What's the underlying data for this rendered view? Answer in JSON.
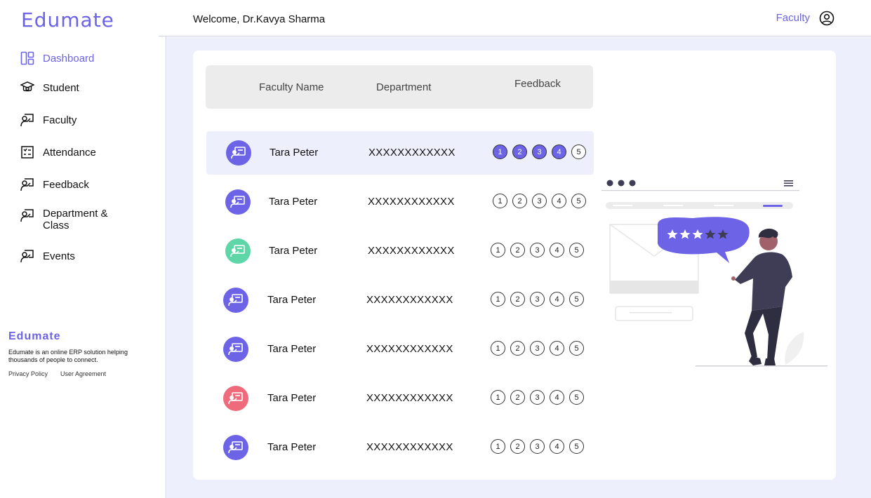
{
  "brand": {
    "name": "Edumate"
  },
  "header": {
    "welcome": "Welcome, Dr.Kavya Sharma",
    "role": "Faculty",
    "profile_icon": "user-circle-icon"
  },
  "sidebar": {
    "items": [
      {
        "label": "Dashboard",
        "icon": "dashboard-icon",
        "active": true
      },
      {
        "label": "Student",
        "icon": "graduation-cap-icon"
      },
      {
        "label": "Faculty",
        "icon": "teacher-icon"
      },
      {
        "label": "Attendance",
        "icon": "checklist-icon"
      },
      {
        "label": "Feedback",
        "icon": "teacher-icon"
      },
      {
        "label": "Department & Class",
        "icon": "teacher-icon"
      },
      {
        "label": "Events",
        "icon": "teacher-icon"
      }
    ]
  },
  "footer": {
    "brand": "Edumate",
    "description": "Edumate is an online ERP solution helping thousands of people to connect.",
    "links": [
      "Privacy Policy",
      "User Agreement"
    ]
  },
  "table": {
    "headers": [
      "Faculty Name",
      "Department",
      "Feedback"
    ],
    "rating_scale": [
      "1",
      "2",
      "3",
      "4",
      "5"
    ],
    "rows": [
      {
        "name": "Tara Peter",
        "department": "XXXXXXXXXXXX",
        "avatar_color": "#6c63e6",
        "rating": 4,
        "highlighted": true
      },
      {
        "name": "Tara Peter",
        "department": "XXXXXXXXXXXX",
        "avatar_color": "#6c63e6",
        "rating": 0
      },
      {
        "name": "Tara Peter",
        "department": "XXXXXXXXXXXX",
        "avatar_color": "#5fd6a8",
        "rating": 0
      },
      {
        "name": "Tara Peter",
        "department": "XXXXXXXXXXXX",
        "avatar_color": "#6c63e6",
        "rating": 0
      },
      {
        "name": "Tara Peter",
        "department": "XXXXXXXXXXXX",
        "avatar_color": "#6c63e6",
        "rating": 0
      },
      {
        "name": "Tara Peter",
        "department": "XXXXXXXXXXXX",
        "avatar_color": "#ef6b7b",
        "rating": 0
      },
      {
        "name": "Tara Peter",
        "department": "XXXXXXXXXXXX",
        "avatar_color": "#6c63e6",
        "rating": 0
      }
    ]
  },
  "colors": {
    "accent": "#6c63e6",
    "background": "#eeeffc"
  }
}
